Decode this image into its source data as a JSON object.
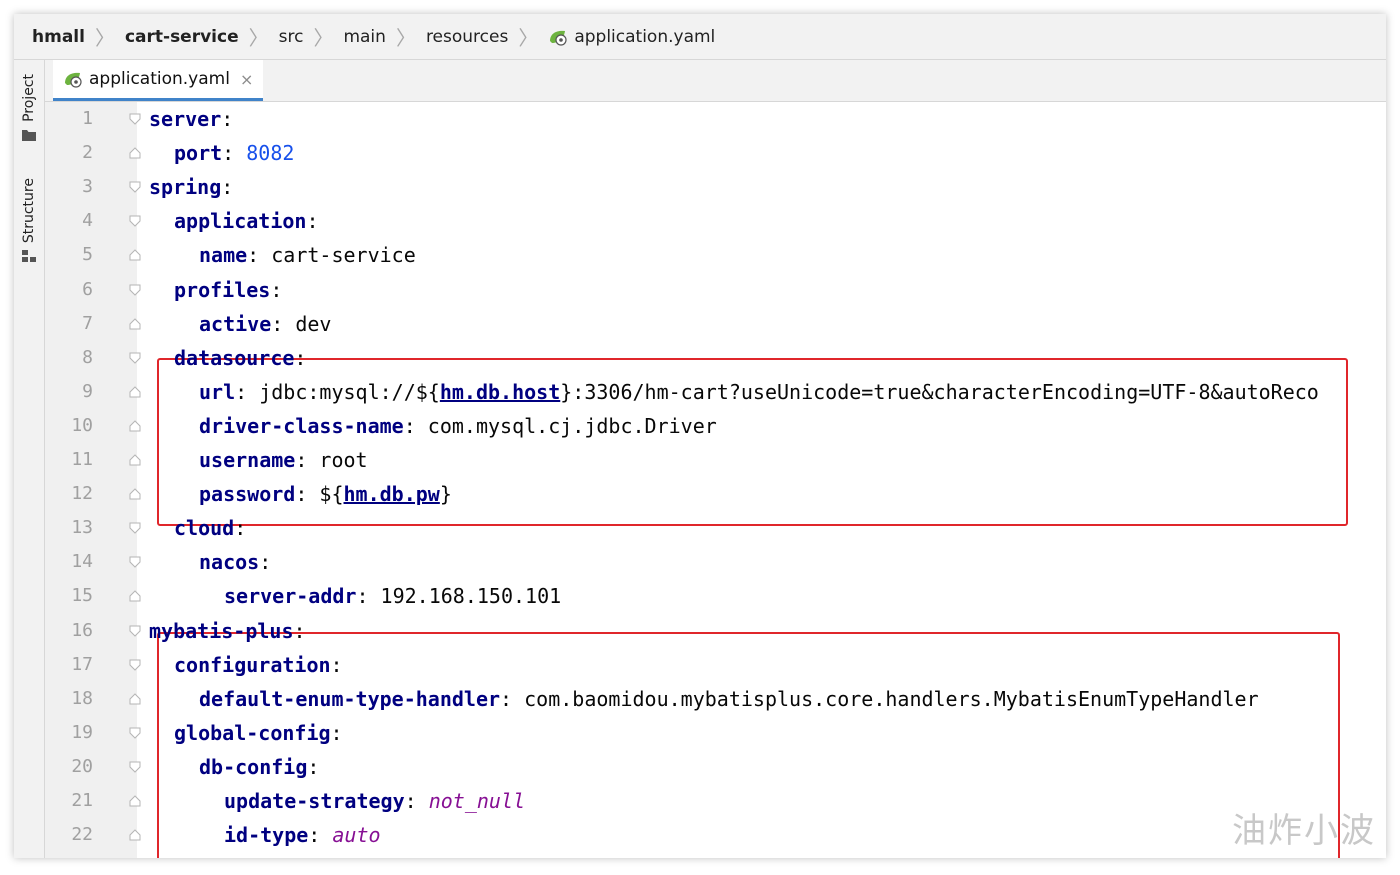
{
  "breadcrumb": [
    {
      "label": "hmall",
      "bold": true
    },
    {
      "label": "cart-service",
      "bold": true
    },
    {
      "label": "src",
      "bold": false
    },
    {
      "label": "main",
      "bold": false
    },
    {
      "label": "resources",
      "bold": false
    },
    {
      "label": "application.yaml",
      "bold": false,
      "icon": "yaml-file-icon"
    }
  ],
  "toolstrip": {
    "project_label": "Project",
    "structure_label": "Structure"
  },
  "tab": {
    "label": "application.yaml",
    "close_glyph": "×",
    "icon": "yaml-file-icon"
  },
  "lines": [
    {
      "n": "1",
      "indent": 0,
      "key": "server",
      "value": ""
    },
    {
      "n": "2",
      "indent": 1,
      "key": "port",
      "value": "8082",
      "value_type": "number"
    },
    {
      "n": "3",
      "indent": 0,
      "key": "spring",
      "value": ""
    },
    {
      "n": "4",
      "indent": 1,
      "key": "application",
      "value": ""
    },
    {
      "n": "5",
      "indent": 2,
      "key": "name",
      "value": "cart-service"
    },
    {
      "n": "6",
      "indent": 1,
      "key": "profiles",
      "value": ""
    },
    {
      "n": "7",
      "indent": 2,
      "key": "active",
      "value": "dev"
    },
    {
      "n": "8",
      "indent": 1,
      "key": "datasource",
      "value": ""
    },
    {
      "n": "9",
      "indent": 2,
      "key": "url",
      "value_parts": [
        "jdbc:mysql://${",
        "hm.db.host",
        "}:3306/hm-cart?useUnicode=true&characterEncoding=UTF-8&autoReco"
      ]
    },
    {
      "n": "10",
      "indent": 2,
      "key": "driver-class-name",
      "value": "com.mysql.cj.jdbc.Driver"
    },
    {
      "n": "11",
      "indent": 2,
      "key": "username",
      "value": "root"
    },
    {
      "n": "12",
      "indent": 2,
      "key": "password",
      "value_parts": [
        "${",
        "hm.db.pw",
        "}"
      ]
    },
    {
      "n": "13",
      "indent": 1,
      "key": "cloud",
      "value": ""
    },
    {
      "n": "14",
      "indent": 2,
      "key": "nacos",
      "value": ""
    },
    {
      "n": "15",
      "indent": 3,
      "key": "server-addr",
      "value": "192.168.150.101"
    },
    {
      "n": "16",
      "indent": 0,
      "key": "mybatis-plus",
      "value": ""
    },
    {
      "n": "17",
      "indent": 1,
      "key": "configuration",
      "value": ""
    },
    {
      "n": "18",
      "indent": 2,
      "key": "default-enum-type-handler",
      "value": "com.baomidou.mybatisplus.core.handlers.MybatisEnumTypeHandler"
    },
    {
      "n": "19",
      "indent": 1,
      "key": "global-config",
      "value": ""
    },
    {
      "n": "20",
      "indent": 2,
      "key": "db-config",
      "value": ""
    },
    {
      "n": "21",
      "indent": 3,
      "key": "update-strategy",
      "value": "not_null",
      "value_type": "keyword"
    },
    {
      "n": "22",
      "indent": 3,
      "key": "id-type",
      "value": "auto",
      "value_type": "keyword"
    }
  ],
  "watermark": "油炸小波",
  "colors": {
    "key": "#000080",
    "number": "#1750eb",
    "keyword": "#871094",
    "highlight_box": "#e0262b",
    "tab_underline": "#4083c9"
  }
}
